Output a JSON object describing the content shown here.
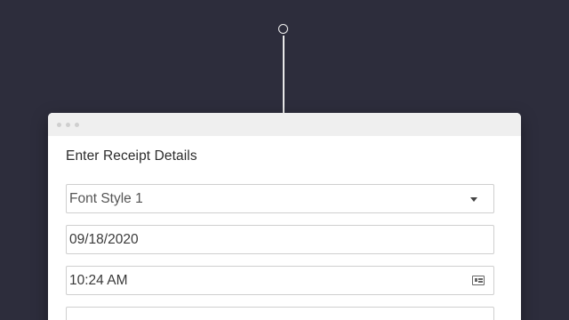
{
  "form": {
    "title": "Enter Receipt Details",
    "font_style": {
      "selected": "Font Style 1",
      "icon": "chevron-down-icon"
    },
    "date": {
      "value": "09/18/2020"
    },
    "time": {
      "value": "10:24 AM",
      "icon": "id-card-icon"
    }
  },
  "colors": {
    "background": "#2d2d3c",
    "window": "#ffffff",
    "titlebar": "#efefef",
    "border": "#cfcfcf"
  }
}
